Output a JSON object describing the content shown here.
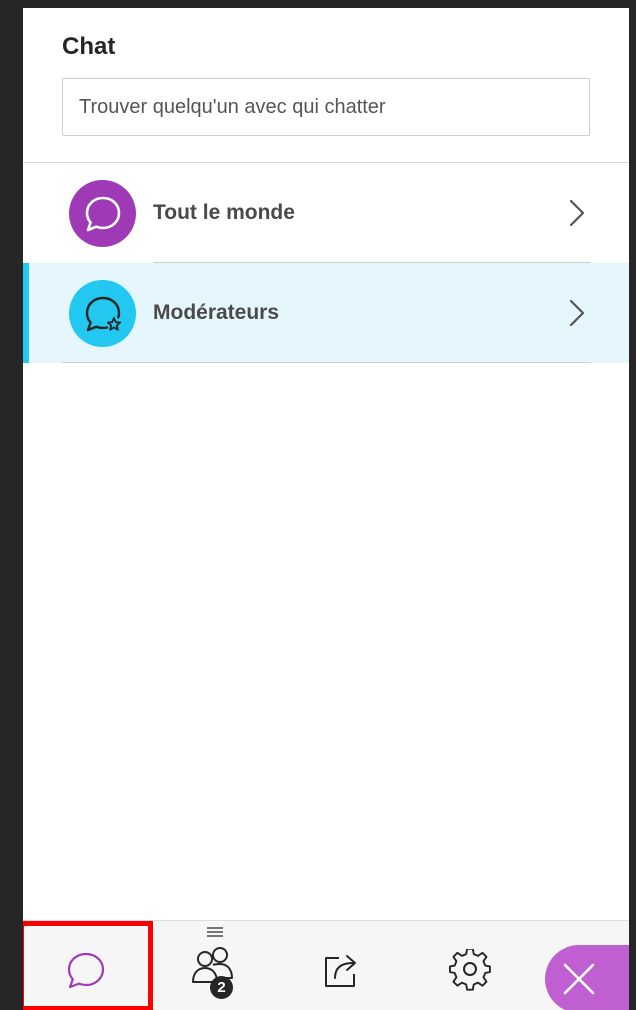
{
  "panel": {
    "title": "Chat",
    "search": {
      "placeholder": "Trouver quelqu'un avec qui chatter",
      "value": ""
    }
  },
  "channels": [
    {
      "label": "Tout le monde",
      "avatar_color": "#9e3ab6",
      "icon": "chat-bubble-icon",
      "selected": false
    },
    {
      "label": "Modérateurs",
      "avatar_color": "#22c8f0",
      "icon": "chat-bubble-star-icon",
      "selected": true
    }
  ],
  "bottom_bar": {
    "participants_count": "2",
    "tabs": [
      {
        "icon": "chat-bubble-icon",
        "active": true
      },
      {
        "icon": "participants-icon"
      },
      {
        "icon": "share-icon"
      },
      {
        "icon": "gear-icon"
      },
      {
        "icon": "close-icon"
      }
    ]
  },
  "colors": {
    "chat_accent": "#9e3ab6",
    "selected_accent": "#22c8f0",
    "selected_background": "#e5f7fd",
    "close_button": "#c05fd2",
    "highlight_box": "#ff0000"
  }
}
